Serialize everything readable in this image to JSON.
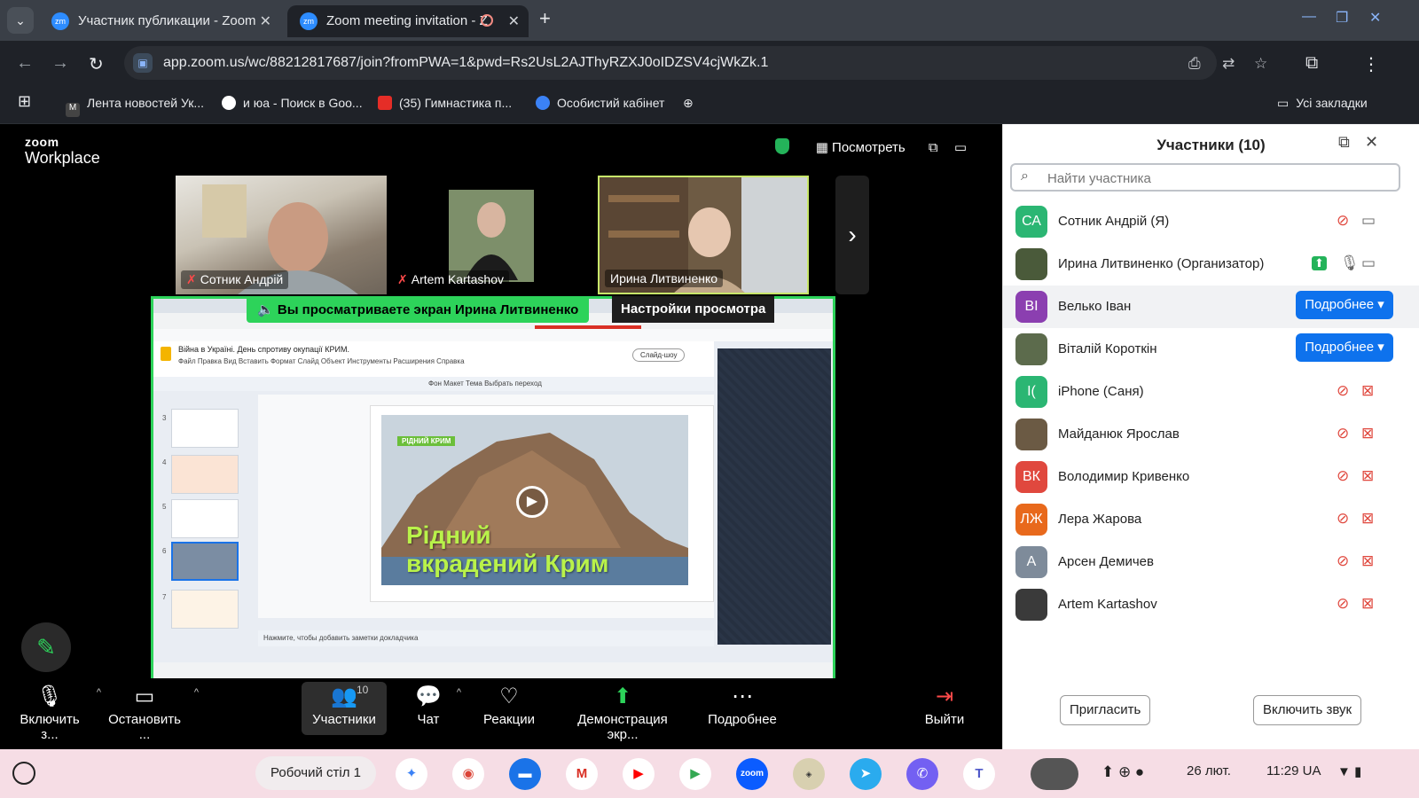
{
  "browser": {
    "tabs": [
      {
        "label": "Участник публикации - Zoom"
      },
      {
        "label": "Zoom meeting invitation - Z"
      }
    ],
    "url": "app.zoom.us/wc/88212817687/join?fromPWA=1&pwd=Rs2UsL2AJThyRZXJ0oIDZSV4cjWkZk.1",
    "bookmarks": [
      "Лента новостей Ук...",
      "и юа - Поиск в Goo...",
      "(35) Гимнастика п...",
      "Особистий кабінет"
    ],
    "all_bookmarks": "Усі закладки"
  },
  "zoom": {
    "logo_top": "zoom",
    "logo_bottom": "Workplace",
    "view_label": "Посмотреть",
    "gallery": [
      {
        "name": "Сотник Андрій",
        "muted": true
      },
      {
        "name": "Artem Kartashov",
        "muted": true
      },
      {
        "name": "Ирина Литвиненко",
        "muted": false
      }
    ],
    "share_banner": "Вы просматриваете экран  Ирина Литвиненко",
    "view_options": "Настройки просмотра",
    "shared": {
      "doc_title": "Війна в Україні. День спротиву окупації КРИМ.",
      "menu": "Файл  Правка  Вид  Вставить  Формат  Слайд  Объект  Инструменты  Расширения  Справка",
      "tools": "Фон    Макет    Тема    Выбрать переход",
      "slide_tag": "РІДНИЙ КРИМ",
      "slide_line1": "Рідний",
      "slide_line2": "вкрадений Крим",
      "notes": "Нажмите, чтобы добавить заметки докладчика",
      "slide_numbers": [
        "3",
        "4",
        "5",
        "6",
        "7"
      ],
      "slideshow_btn": "Слайд-шоу"
    },
    "controls": {
      "mic": "Включить з...",
      "video": "Остановить ...",
      "participants": "Участники",
      "participants_count": "10",
      "chat": "Чат",
      "reactions": "Реакции",
      "share": "Демонстрация экр...",
      "more": "Подробнее",
      "leave": "Выйти"
    }
  },
  "panel": {
    "title": "Участники (10)",
    "search_placeholder": "Найти участника",
    "participants": [
      {
        "initials": "СА",
        "name": "Сотник Андрій (Я)",
        "color": "#2bb673",
        "mic": "muted",
        "video": "on"
      },
      {
        "initials": "",
        "name": "Ирина Литвиненко (Организатор)",
        "color": "#4a5a3a",
        "mic": "on",
        "video": "on",
        "sharing": true
      },
      {
        "initials": "ВІ",
        "name": "Велько Іван",
        "color": "#8b3fb0",
        "more": "Подробнее"
      },
      {
        "initials": "",
        "name": "Віталій Короткін",
        "color": "#5c6b4c",
        "more": "Подробнее"
      },
      {
        "initials": "I(",
        "name": "iPhone (Саня)",
        "color": "#2bb673",
        "mic": "muted",
        "video": "off"
      },
      {
        "initials": "",
        "name": "Майданюк Ярослав",
        "color": "#6b5a44",
        "mic": "muted",
        "video": "off"
      },
      {
        "initials": "ВК",
        "name": "Володимир Кривенко",
        "color": "#e0483e",
        "mic": "muted",
        "video": "off"
      },
      {
        "initials": "ЛЖ",
        "name": "Лера Жарова",
        "color": "#e8691c",
        "mic": "muted",
        "video": "off"
      },
      {
        "initials": "А",
        "name": "Арсен Демичев",
        "color": "#7e8b9a",
        "mic": "muted",
        "video": "off"
      },
      {
        "initials": "",
        "name": "Artem Kartashov",
        "color": "#3a3a3a",
        "mic": "muted",
        "video": "off"
      }
    ],
    "invite": "Пригласить",
    "unmute": "Включить звук"
  },
  "shelf": {
    "desk": "Робочий стіл 1",
    "date": "26 лют.",
    "time": "11:29",
    "locale": "UA"
  }
}
